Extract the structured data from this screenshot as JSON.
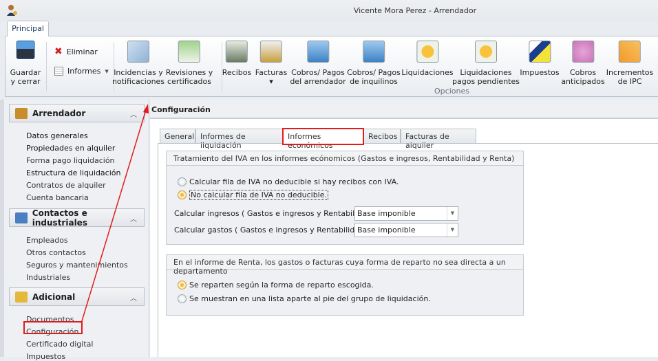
{
  "window": {
    "title": "Vicente Mora Perez - Arrendador"
  },
  "ribbon": {
    "tab": "Principal",
    "group_label": "Opciones",
    "save": {
      "line1": "Guardar",
      "line2": "y cerrar"
    },
    "delete": "Eliminar",
    "reports": "Informes",
    "buttons": [
      {
        "l1": "Incidencias y",
        "l2": "notificaciones",
        "icon": "clipboard-check-icon"
      },
      {
        "l1": "Revisiones y",
        "l2": "certificados",
        "icon": "bell-notebook-icon"
      },
      {
        "l1": "Recibos",
        "l2": "",
        "icon": "receipt-icon"
      },
      {
        "l1": "Facturas",
        "l2": "▾",
        "icon": "invoice-coins-icon"
      },
      {
        "l1": "Cobros/ Pagos",
        "l2": "del arrendador",
        "icon": "calculator-icon"
      },
      {
        "l1": "Cobros/ Pagos",
        "l2": "de inquilinos",
        "icon": "calculator-person-icon"
      },
      {
        "l1": "Liquidaciones",
        "l2": "",
        "icon": "certificate-icon"
      },
      {
        "l1": "Liquidaciones",
        "l2": "pagos pendientes",
        "icon": "certificate-pending-icon"
      },
      {
        "l1": "Impuestos",
        "l2": "",
        "icon": "tax-agency-icon"
      },
      {
        "l1": "Cobros",
        "l2": "anticipados",
        "icon": "piggy-bank-icon"
      },
      {
        "l1": "Incrementos",
        "l2": "de IPC",
        "icon": "increase-arrow-icon"
      }
    ]
  },
  "sidebar": {
    "groups": [
      {
        "title": "Arrendador",
        "items": [
          "Datos generales",
          "Propiedades en alquiler",
          "Forma pago liquidación",
          "Estructura de liquidación",
          "Contratos de alquiler",
          "Cuenta bancaria"
        ]
      },
      {
        "title": "Contactos e industriales",
        "items": [
          "Empleados",
          "Otros contactos",
          "Seguros y mantenimientos",
          "Industriales"
        ]
      },
      {
        "title": "Adicional",
        "items": [
          "Documentos",
          "Configuración",
          "Certificado digital",
          "Impuestos"
        ]
      }
    ]
  },
  "main": {
    "title": "Configuración",
    "tabs": [
      "General",
      "Informes de liquidación",
      "Informes económicos",
      "Recibos",
      "Facturas de alquiler"
    ],
    "active_tab": "Informes económicos",
    "iva": {
      "title": "Tratamiento del IVA en los informes ecónomicos (Gastos e ingresos, Rentabilidad y Renta)",
      "option1": "Calcular fila de IVA no deducible si hay recibos con IVA.",
      "option2": "No calcular fila de IVA no deducible.",
      "selected": 2,
      "ingresos_label": "Calcular ingresos ( Gastos e ingresos y Rentabilidad ):",
      "ingresos_value": "Base imponible",
      "gastos_label": "Calcular gastos ( Gastos e ingresos y Rentabilidad ):",
      "gastos_value": "Base imponible"
    },
    "renta": {
      "title": "En el informe de Renta, los gastos o facturas cuya forma de reparto no sea directa a un departamento",
      "option1": "Se reparten según la forma de reparto escogida.",
      "option2": "Se muestran en una lista aparte al pie del grupo de liquidación.",
      "selected": 1
    }
  },
  "colors": {
    "highlight": "#e21b1b",
    "accent": "#f6b93a"
  }
}
